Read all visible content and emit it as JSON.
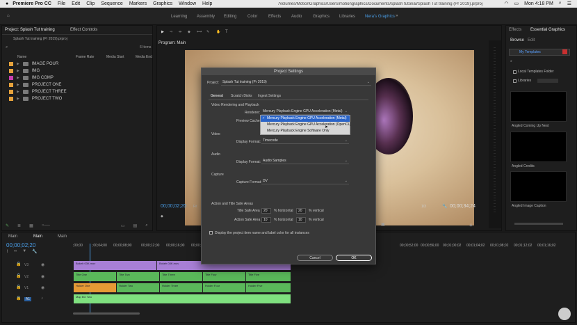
{
  "menubar": {
    "app": "Premiere Pro CC",
    "items": [
      "File",
      "Edit",
      "Clip",
      "Sequence",
      "Markers",
      "Graphics",
      "Window",
      "Help"
    ],
    "path": "/Volumes/MotionGraphics/Users/motiongraphics/Documents/splash tutorial/Splash Tut training (Pr 2019).prproj",
    "clock": "Mon 4:18 PM"
  },
  "workspaces": [
    "Learning",
    "Assembly",
    "Editing",
    "Color",
    "Effects",
    "Audio",
    "Graphics",
    "Libraries",
    "Nera's Graphics"
  ],
  "project": {
    "tab": "Project: Splash Tut training",
    "tab2": "Effect Controls",
    "file": "Splash Tut training (Pr 2019).prproj",
    "items_count": "6 Items",
    "cols": [
      "Name",
      "Frame Rate",
      "Media Start",
      "Media End"
    ],
    "bins": [
      {
        "name": "IMAGE POUR",
        "color": "#e6a23c",
        "fold": false
      },
      {
        "name": "IMG",
        "color": "#e6a23c",
        "fold": false
      },
      {
        "name": "IMG COMP",
        "color": "#c83fb0",
        "fold": false
      },
      {
        "name": "PROJECT ONE",
        "color": "#e6a23c",
        "fold": true
      },
      {
        "name": "PROJECT THREE",
        "color": "#e6a23c",
        "fold": true
      },
      {
        "name": "PROJECT TWO",
        "color": "#e6a23c",
        "fold": true
      }
    ]
  },
  "program": {
    "title": "Program: Main",
    "timecode_left": "00;00;02;20",
    "fit": "Fit",
    "fraction": "1/3",
    "timecode_right": "00;00;34;24"
  },
  "timeline": {
    "tab1": "Main",
    "tab2": "Main",
    "timecode": "00;00;02;20",
    "ruler": [
      ";00;00",
      ";00;04;00",
      "00;00;08;00",
      "00;00;12;00",
      "00;00;16;00",
      "00;00;20;00",
      "00;00;52;00",
      "00;00;56;00",
      "00;01;00;02",
      "00;01;04;02",
      "00;01;08;02",
      "00;01;12;02",
      "00;01;16;02"
    ],
    "tracks": [
      "V3",
      "V2",
      "V1",
      "A1"
    ],
    "clips": [
      {
        "label": "Bokeh 03K.mov",
        "track": 0
      },
      {
        "label": "Bokeh 03K.mov",
        "track": 0
      },
      {
        "label": "Title One",
        "track": 1
      },
      {
        "label": "Title Two",
        "track": 1
      },
      {
        "label": "Title Three",
        "track": 1
      },
      {
        "label": "Title Four",
        "track": 1
      },
      {
        "label": "Title Five",
        "track": 1
      },
      {
        "label": "Holder One",
        "track": 2
      },
      {
        "label": "Holder Two",
        "track": 2
      },
      {
        "label": "Holder Three",
        "track": 2
      },
      {
        "label": "Holder Four",
        "track": 2
      },
      {
        "label": "Holder Five",
        "track": 2
      },
      {
        "label": "Map BG Two",
        "track": 3
      }
    ]
  },
  "right": {
    "tab1": "Effects",
    "tab2": "Essential Graphics",
    "sub1": "Browse",
    "sub2": "Edit",
    "templates": "My Templates",
    "local": "Local Templates Folder",
    "libraries": "Libraries",
    "thumbs": [
      "Angled Coming Up Next",
      "Angled Credits",
      "Angled Image Caption"
    ]
  },
  "dialog": {
    "title": "Project Settings",
    "project_label": "Project:",
    "project_value": "Splash Tut training (Pr 2019)",
    "tabs": [
      "General",
      "Scratch Disks",
      "Ingest Settings"
    ],
    "video_rp": "Video Rendering and Playback",
    "renderer_label": "Renderer:",
    "renderer_value": "Mercury Playback Engine GPU Acceleration (Metal)",
    "preview_label": "Preview Cache:",
    "options": [
      "Mercury Playback Engine GPU Acceleration (Metal)",
      "Mercury Playback Engine GPU Acceleration (OpenCL)",
      "Mercury Playback Engine Software Only"
    ],
    "video": "Video",
    "display_format_label": "Display Format:",
    "video_format": "Timecode",
    "audio": "Audio",
    "audio_format": "Audio Samples",
    "capture": "Capture",
    "capture_label": "Capture Format:",
    "capture_value": "DV",
    "safe": "Action and Title Safe Areas",
    "title_safe": "Title Safe Area",
    "action_safe": "Action Safe Area",
    "ts_h": "20",
    "ts_v": "20",
    "as_h": "10",
    "as_v": "10",
    "pct_h": "% horizontal",
    "pct_v": "% vertical",
    "checkbox": "Display the project item name and label color for all instances",
    "cancel": "Cancel",
    "ok": "OK"
  }
}
